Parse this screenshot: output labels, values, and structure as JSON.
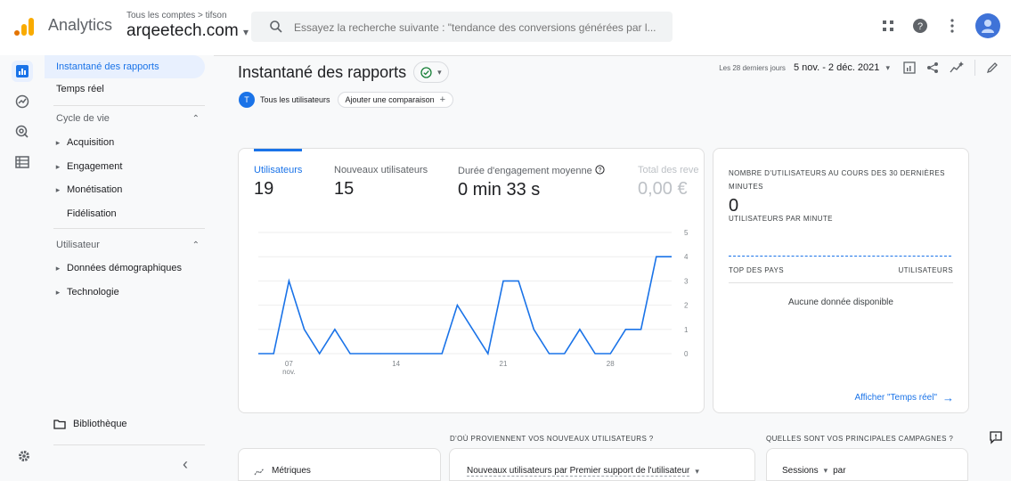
{
  "header": {
    "app_name": "Analytics",
    "breadcrumb": "Tous les comptes > tifson",
    "property": "arqeetech.com",
    "property_caret": "▾",
    "search_placeholder": "Essayez la recherche suivante : \"tendance des conversions générées par l...",
    "icons": [
      "logo-bars-icon",
      "apps-grid-icon",
      "help-icon",
      "more-vert-icon",
      "account-icon"
    ]
  },
  "rail": {
    "icons": [
      "reports-icon",
      "explore-icon",
      "advertising-icon",
      "configure-icon",
      "settings-icon"
    ]
  },
  "nav": {
    "items": [
      {
        "label": "Instantané des rapports",
        "active": true
      },
      {
        "label": "Temps réel"
      }
    ],
    "sections": [
      {
        "label": "Cycle de vie",
        "items": [
          {
            "label": "Acquisition",
            "caret": "▸"
          },
          {
            "label": "Engagement",
            "caret": "▸"
          },
          {
            "label": "Monétisation",
            "caret": "▸"
          },
          {
            "label": "Fidélisation",
            "caret": ""
          }
        ]
      },
      {
        "label": "Utilisateur",
        "items": [
          {
            "label": "Données démographiques",
            "caret": "▸"
          },
          {
            "label": "Technologie",
            "caret": "▸"
          }
        ]
      }
    ],
    "library_label": "Bibliothèque",
    "collapse": "‹"
  },
  "page": {
    "title": "Instantané des rapports",
    "date_small": "Les 28 derniers jours",
    "date_range": "5 nov. - 2 déc. 2021",
    "date_caret": "▾",
    "comparison_chip": {
      "badge": "T",
      "label": "Tous les utilisateurs"
    },
    "add_comparison": "Ajouter une comparaison",
    "add_comparison_icon": "+"
  },
  "metrics": [
    {
      "label": "Utilisateurs",
      "value": "19"
    },
    {
      "label": "Nouveaux utilisateurs",
      "value": "15"
    },
    {
      "label": "Durée d'engagement moyenne",
      "value": "0 min 33 s"
    },
    {
      "label": "Total des reve",
      "value": "0,00 €"
    }
  ],
  "chart_data": {
    "type": "line",
    "x_ticks": [
      {
        "day": 7,
        "label": "07",
        "sub": "nov."
      },
      {
        "day": 14,
        "label": "14"
      },
      {
        "day": 21,
        "label": "21"
      },
      {
        "day": 28,
        "label": "28"
      }
    ],
    "x_range": [
      5,
      32
    ],
    "x": [
      5,
      6,
      7,
      8,
      9,
      10,
      11,
      12,
      13,
      14,
      15,
      16,
      17,
      18,
      19,
      20,
      21,
      22,
      23,
      24,
      25,
      26,
      27,
      28,
      29,
      30,
      31,
      32
    ],
    "values": [
      0,
      0,
      3,
      1,
      0,
      1,
      0,
      0,
      0,
      0,
      0,
      0,
      0,
      2,
      1,
      0,
      3,
      3,
      1,
      0,
      0,
      1,
      0,
      0,
      1,
      1,
      4,
      4
    ],
    "y_ticks": [
      0,
      1,
      2,
      3,
      4,
      5
    ],
    "ylim": [
      0,
      5
    ],
    "grid": true,
    "color": "#1a73e8"
  },
  "realtime": {
    "title": "NOMBRE D'UTILISATEURS AU COURS DES 30 DERNIÈRES MINUTES",
    "value": "0",
    "subtitle": "UTILISATEURS PAR MINUTE",
    "col_country": "TOP DES PAYS",
    "col_users": "UTILISATEURS",
    "empty": "Aucune donnée disponible",
    "link": "Afficher \"Temps réel\"",
    "link_arrow": "→"
  },
  "bottom": {
    "q1": "D'OÙ PROVIENNENT VOS NOUVEAUX UTILISATEURS ?",
    "q2": "QUELLES SONT VOS PRINCIPALES CAMPAGNES ?",
    "card1_label": "Métriques",
    "card2_label": "Nouveaux utilisateurs par Premier support de l'utilisateur",
    "card2_caret": "▾",
    "card3_label": "Sessions",
    "card3_caret": "▾",
    "card3_suffix": "par"
  },
  "colors": {
    "accent": "#1a73e8",
    "logo_orange": "#f9ab00",
    "logo_dark": "#e37400"
  }
}
